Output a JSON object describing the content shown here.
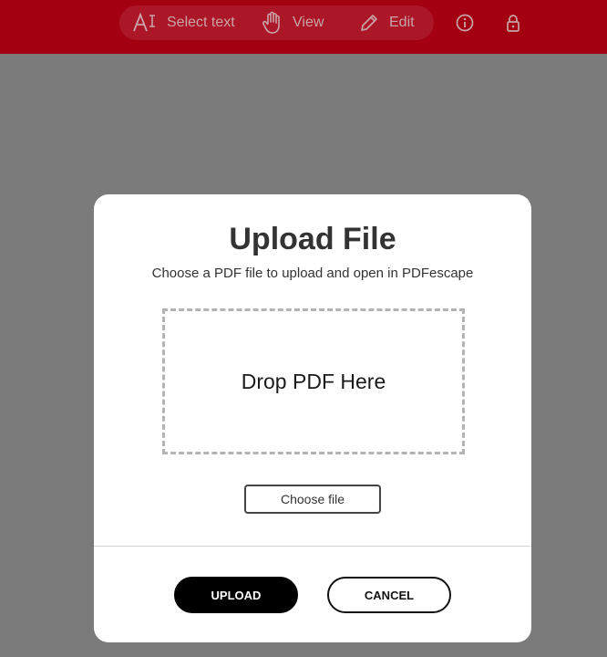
{
  "toolbar": {
    "select_text_label": "Select text",
    "view_label": "View",
    "edit_label": "Edit",
    "icons": {
      "select_text": "text-cursor-icon",
      "view": "hand-icon",
      "edit": "pencil-icon",
      "info": "info-icon",
      "lock": "lock-icon"
    },
    "bar_color": "#a30012"
  },
  "dialog": {
    "title": "Upload File",
    "subtitle": "Choose a PDF file to upload and open in PDFescape",
    "dropzone_label": "Drop PDF Here",
    "choose_file_label": "Choose file",
    "upload_label": "UPLOAD",
    "cancel_label": "CANCEL"
  }
}
